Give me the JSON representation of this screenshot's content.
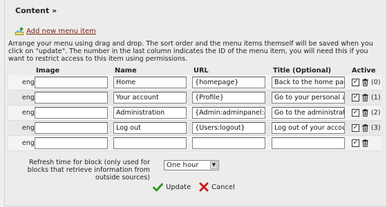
{
  "section": {
    "title": "Content »"
  },
  "add_link": {
    "label": "Add new menu item",
    "icon": "add-menu-icon"
  },
  "description": "Arrange your menu using drag and drop. The sort order and the menu items themself will be saved when you click on \"update\". The number in the last column indicates the ID of the menu item, you will need this if you want to restrict access to this item using permissions.",
  "table": {
    "headers": {
      "image": "Image",
      "name": "Name",
      "url": "URL",
      "title": "Title (Optional)",
      "active": "Active"
    },
    "rows": [
      {
        "lang": "eng",
        "image": "",
        "name": "Home",
        "url": "{homepage}",
        "title": "Back to the home page",
        "active": true,
        "id": "(0)"
      },
      {
        "lang": "eng",
        "image": "",
        "name": "Your account",
        "url": "{Profile}",
        "title": "Go to your personal account",
        "active": true,
        "id": "(1)"
      },
      {
        "lang": "eng",
        "image": "",
        "name": "Administration",
        "url": "{Admin:adminpanel:a",
        "title": "Go to the administration",
        "active": true,
        "id": "(2)"
      },
      {
        "lang": "eng",
        "image": "",
        "name": "Log out",
        "url": "{Users:logout}",
        "title": "Log out of your account",
        "active": true,
        "id": "(3)"
      },
      {
        "lang": "eng",
        "image": "",
        "name": "",
        "url": "",
        "title": "",
        "active": true,
        "id": ""
      }
    ]
  },
  "refresh": {
    "label": "Refresh time for block (only used for blocks that retrieve information from outside sources)",
    "value": "One hour"
  },
  "actions": {
    "update": "Update",
    "cancel": "Cancel"
  },
  "colors": {
    "link": "#7a1d0a",
    "check": "#2e9a1c",
    "cross": "#c81e1e"
  }
}
